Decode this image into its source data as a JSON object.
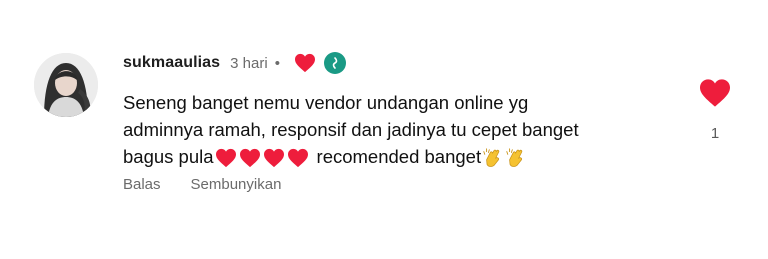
{
  "comment": {
    "username": "sukmaaulias",
    "time": "3 hari",
    "separator": "•",
    "text_lines": [
      "Seneng banget nemu vendor undangan online yg",
      "adminnya ramah, responsif dan jadinya tu cepet banget",
      "bagus pula"
    ],
    "text_tail": "recomended banget",
    "hearts_emoji_count": 4,
    "clap_emoji_count": 2,
    "actions": {
      "reply": "Balas",
      "hide": "Sembunyikan"
    },
    "like_count": "1"
  },
  "icons": {
    "creator_heart": "heart-icon",
    "creator_avatar": "creator-avatar",
    "like": "heart-icon",
    "emoji_heart": "red-heart-emoji",
    "emoji_clap": "clapping-hands-emoji"
  },
  "colors": {
    "heart_red": "#ee1d3c",
    "meta_gray": "#6b6b6b",
    "creator_teal": "#1a9a85",
    "clap_yellow": "#f5c231"
  }
}
